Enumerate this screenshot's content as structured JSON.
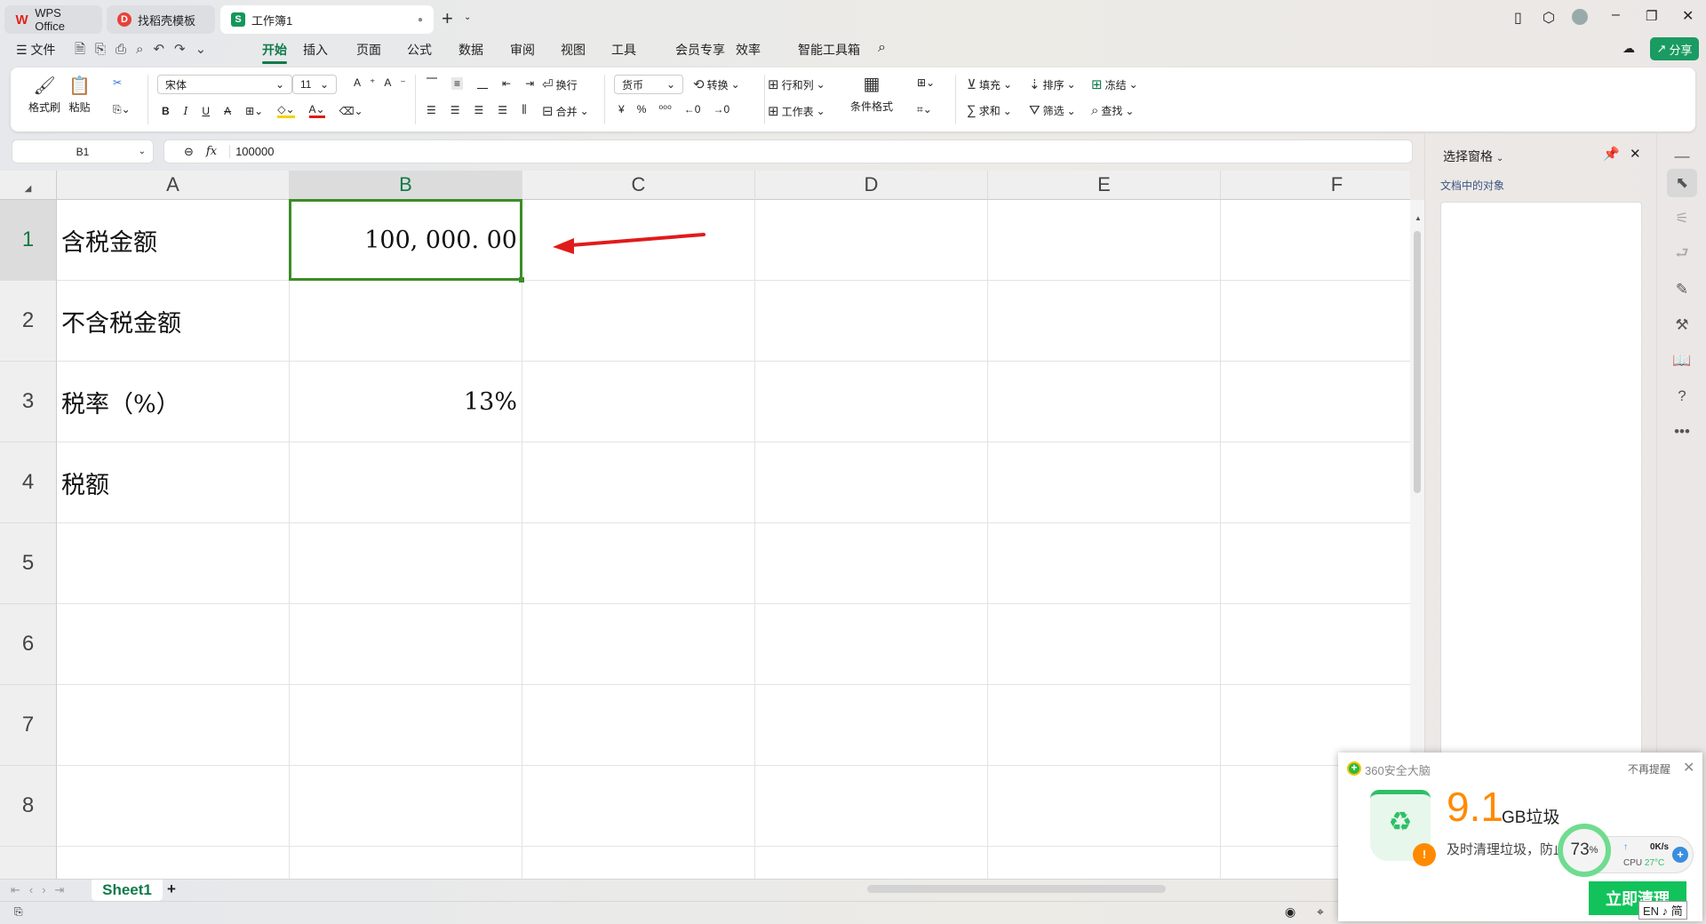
{
  "tabs": [
    {
      "label": "WPS Office",
      "icon": "wps-logo"
    },
    {
      "label": "找稻壳模板",
      "icon": "docer-logo"
    },
    {
      "label": "工作簿1",
      "icon": "sheet-logo"
    }
  ],
  "menu": {
    "file": "文件",
    "items": [
      "开始",
      "插入",
      "页面",
      "公式",
      "数据",
      "审阅",
      "视图",
      "工具",
      "会员专享",
      "效率",
      "智能工具箱"
    ],
    "active": "开始",
    "share": "分享"
  },
  "ribbon": {
    "format_painter": "格式刷",
    "paste": "粘贴",
    "font": "宋体",
    "size": "11",
    "wrap": "换行",
    "merge": "合并",
    "number_format": "货币",
    "convert": "转换",
    "rowcol": "行和列",
    "worksheet": "工作表",
    "cond_format": "条件格式",
    "fill": "填充",
    "sort": "排序",
    "freeze": "冻结",
    "sum": "求和",
    "filter": "筛选",
    "find": "查找",
    "bold": "B",
    "italic": "I",
    "underline": "U",
    "currency": "¥",
    "percent": "%"
  },
  "formula": {
    "name_box": "B1",
    "fx": "fx",
    "value": "100000"
  },
  "grid": {
    "columns": [
      "A",
      "B",
      "C",
      "D",
      "E",
      "F"
    ],
    "selected_col": "B",
    "selected_row": 1,
    "rows": [
      "1",
      "2",
      "3",
      "4",
      "5",
      "6",
      "7",
      "8"
    ],
    "cells": [
      [
        "含税金额",
        "100, 000. 00"
      ],
      [
        "不含税金额",
        ""
      ],
      [
        "税率（%）",
        "13%"
      ],
      [
        "税额",
        ""
      ]
    ]
  },
  "pane": {
    "title": "选择窗格",
    "subtitle": "文档中的对象"
  },
  "sheets": {
    "tabs": [
      "Sheet1"
    ],
    "active": "Sheet1",
    "add": "+"
  },
  "popup": {
    "brand": "360安全大脑",
    "dismiss": "不再提醒",
    "size": "9.1",
    "unit": "GB垃圾",
    "desc": "及时清理垃圾，防止",
    "gauge": "73",
    "gauge_unit": "%",
    "speed": "0K/s",
    "cpu_label": "CPU",
    "cpu_temp": "27°C",
    "button": "立即清理",
    "ime": "EN ♪ 简"
  },
  "colors": {
    "accent": "#0f7a4a",
    "share_bg": "#1a9b62",
    "selection": "#3c8d27",
    "arrow": "#e01b1b",
    "orange": "#ff8a00"
  }
}
